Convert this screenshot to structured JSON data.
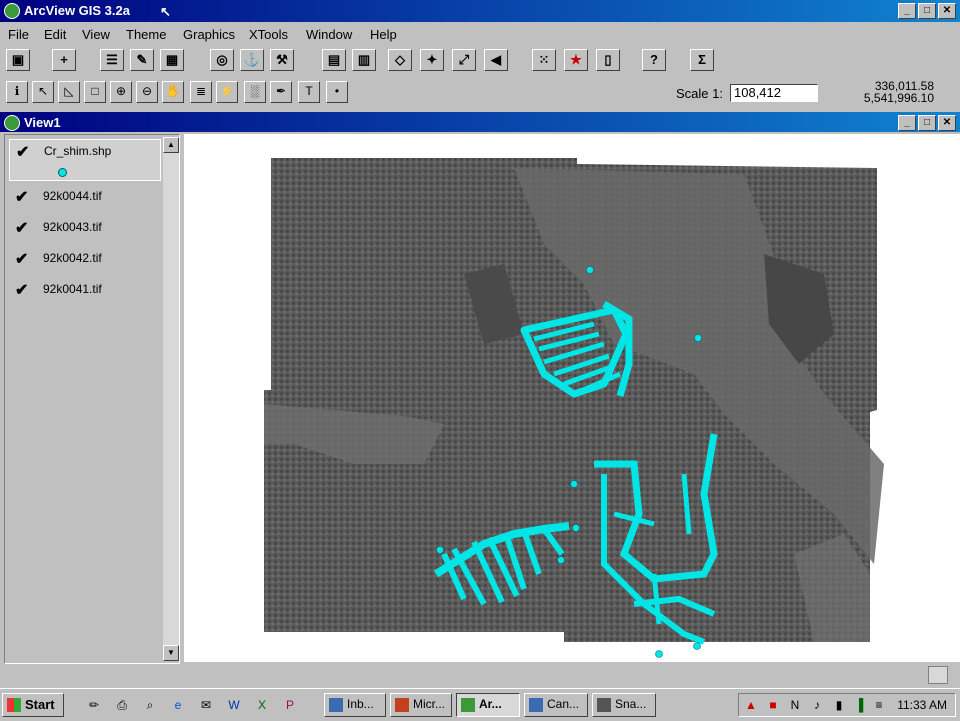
{
  "app": {
    "title": "ArcView GIS 3.2a"
  },
  "menu": [
    "File",
    "Edit",
    "View",
    "Theme",
    "Graphics",
    "XTools",
    "Window",
    "Help"
  ],
  "scale": {
    "label": "Scale 1:",
    "value": "108,412"
  },
  "coords": {
    "x": "336,011.58",
    "y": "5,541,996.10"
  },
  "view": {
    "title": "View1"
  },
  "toc": {
    "layers": [
      {
        "name": "Cr_shim.shp",
        "checked": true,
        "active": true,
        "symbol_color": "#00e5e5"
      },
      {
        "name": "92k0044.tif",
        "checked": true
      },
      {
        "name": "92k0043.tif",
        "checked": true
      },
      {
        "name": "92k0042.tif",
        "checked": true
      },
      {
        "name": "92k0041.tif",
        "checked": true
      }
    ]
  },
  "map": {
    "point_color": "#00e5e5",
    "imagery": "grayscale aerial photo mosaic"
  },
  "taskbar": {
    "start": "Start",
    "tasks": [
      "Inb...",
      "Micr...",
      "Ar...",
      "Can...",
      "Sna..."
    ],
    "active_task": "Ar...",
    "clock": "11:33 AM"
  },
  "icons": [
    "save-icon",
    "add-theme-icon",
    "open-table-icon",
    "zoom-in-icon",
    "pan-icon",
    "identify-icon",
    "select-icon",
    "text-tool-icon",
    "sum-icon",
    "help-icon"
  ]
}
